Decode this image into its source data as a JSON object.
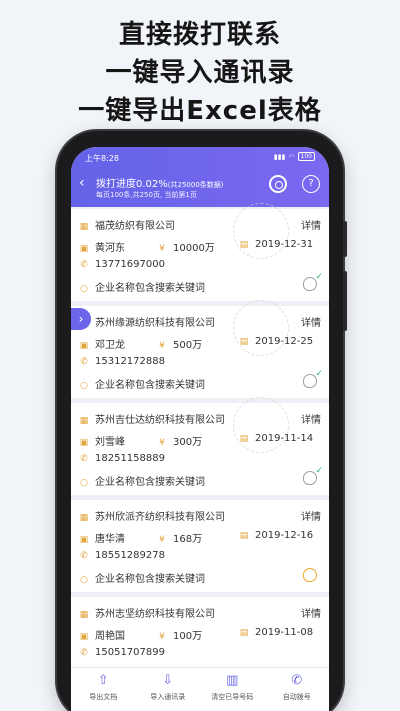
{
  "promo": {
    "line1": "直接拨打联系",
    "line2": "一键导入通讯录",
    "line3": "一键导出Excel表格"
  },
  "status_bar": {
    "time": "上午8:28",
    "battery": "100"
  },
  "header": {
    "back_icon": "‹",
    "progress_label": "拨打进度0.02%",
    "progress_sub": "(共25000条数据)",
    "pager": "每页100条,共250页, 当前第1页",
    "help_icon": "?"
  },
  "expand_icon": "›",
  "records": [
    {
      "company": "福茂纺织有限公司",
      "detail": "详情",
      "person": "黄河东",
      "capital": "10000万",
      "date": "2019-12-31",
      "phone": "13771697000",
      "hint": "企业名称包含搜索关键词",
      "called": true
    },
    {
      "company": "苏州缘源纺织科技有限公司",
      "detail": "详情",
      "person": "邓卫龙",
      "capital": "500万",
      "date": "2019-12-25",
      "phone": "15312172888",
      "hint": "企业名称包含搜索关键词",
      "called": true
    },
    {
      "company": "苏州吉仕达纺织科技有限公司",
      "detail": "详情",
      "person": "刘雪峰",
      "capital": "300万",
      "date": "2019-11-14",
      "phone": "18251158889",
      "hint": "企业名称包含搜索关键词",
      "called": true
    },
    {
      "company": "苏州欣派齐纺织科技有限公司",
      "detail": "详情",
      "person": "唐华清",
      "capital": "168万",
      "date": "2019-12-16",
      "phone": "18551289278",
      "hint": "企业名称包含搜索关键词",
      "called": false
    },
    {
      "company": "苏州志坚纺织科技有限公司",
      "detail": "详情",
      "person": "周艳国",
      "capital": "100万",
      "date": "2019-11-08",
      "phone": "15051707899",
      "hint": "",
      "called": false
    }
  ],
  "bottom_nav": {
    "export": "导出文档",
    "import": "导入通讯录",
    "clear": "清空已导号码",
    "autodial": "自动拨号"
  },
  "icons": {
    "company": "building-icon",
    "person": "id-card-icon",
    "capital": "coin-icon",
    "date": "calendar-icon",
    "phone": "phone-icon",
    "search": "search-icon"
  },
  "colors": {
    "accent": "#6b6ae6",
    "called": "#2ab36b",
    "pending": "#f0a82a"
  }
}
